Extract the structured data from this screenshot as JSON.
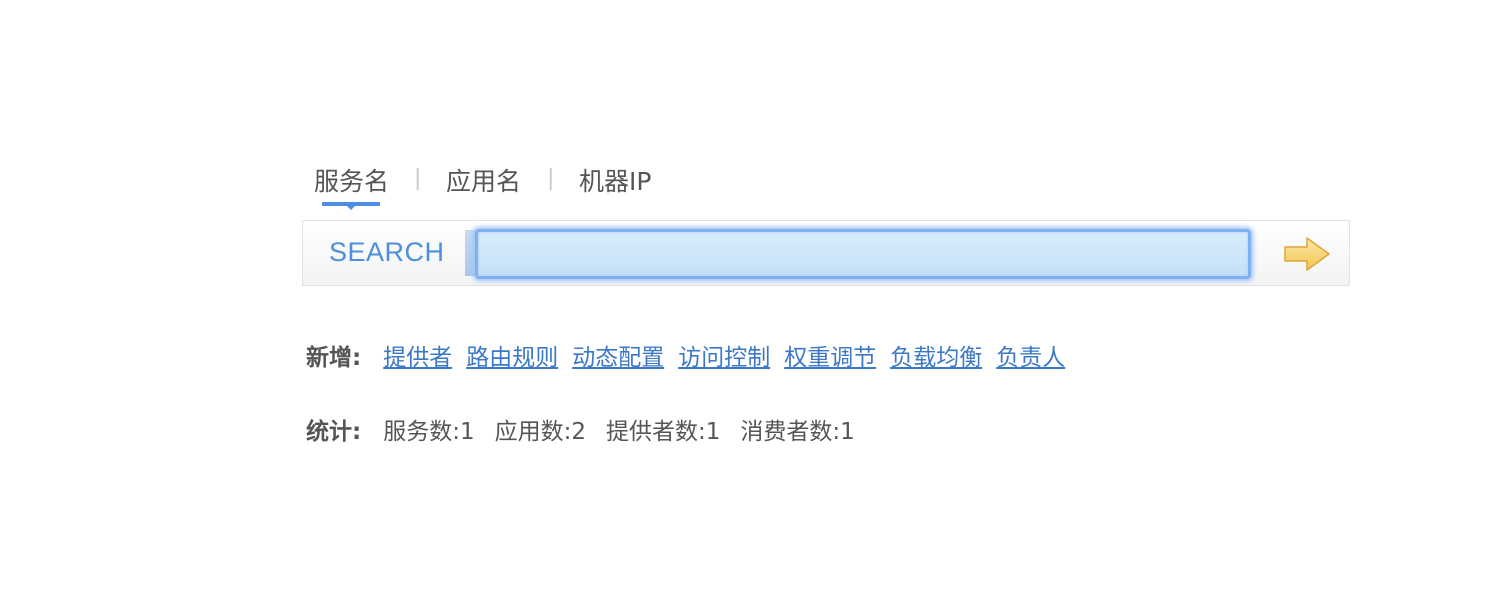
{
  "search": {
    "tabs": [
      {
        "label": "服务名",
        "active": true
      },
      {
        "label": "应用名",
        "active": false
      },
      {
        "label": "机器IP",
        "active": false
      }
    ],
    "separator": "|",
    "label": "SEARCH",
    "value": "",
    "placeholder": "",
    "submit_icon": "arrow-right-icon",
    "accent_color": "#4f8fdd"
  },
  "add": {
    "label": "新增:",
    "links": [
      "提供者",
      "路由规则",
      "动态配置",
      "访问控制",
      "权重调节",
      "负载均衡",
      "负责人"
    ],
    "link_color": "#3d78c6"
  },
  "stats": {
    "label": "统计:",
    "items": [
      "服务数:1",
      "应用数:2",
      "提供者数:1",
      "消费者数:1"
    ]
  }
}
